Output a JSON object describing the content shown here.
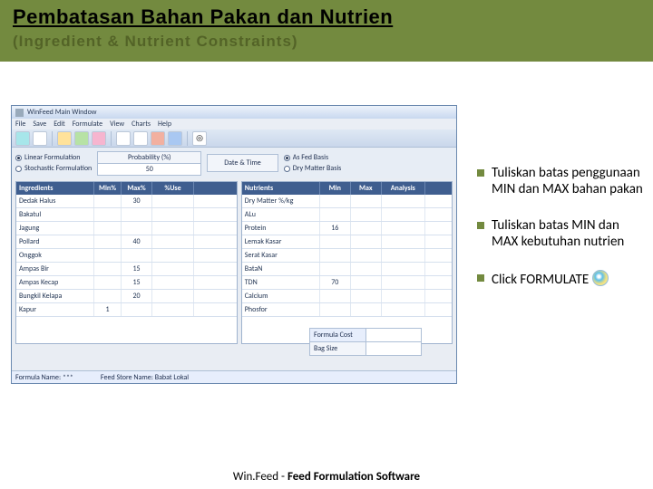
{
  "header": {
    "title": "Pembatasan Bahan Pakan dan Nutrien",
    "subtitle": "(Ingredient & Nutrient Constraints)"
  },
  "app": {
    "title": "WinFeed Main Window",
    "menu": [
      "File",
      "Save",
      "Edit",
      "Formulate",
      "View",
      "Charts",
      "Help"
    ],
    "options": {
      "linear_label": "Linear Formulation",
      "stochastic_label": "Stochastic Formulation",
      "prob_label": "Probability (%)",
      "prob_value": "50",
      "date_label": "Date & Time",
      "asfed_label": "As Fed Basis",
      "drymatter_label": "Dry Matter Basis"
    },
    "ing_head": [
      "Ingredients",
      "Min%",
      "Max%",
      "%Use"
    ],
    "ingredients": [
      {
        "name": "Dedak Halus",
        "min": "",
        "max": "30",
        "use": ""
      },
      {
        "name": "Bakatul",
        "min": "",
        "max": "",
        "use": ""
      },
      {
        "name": "Jagung",
        "min": "",
        "max": "",
        "use": ""
      },
      {
        "name": "Pollard",
        "min": "",
        "max": "40",
        "use": ""
      },
      {
        "name": "Onggok",
        "min": "",
        "max": "",
        "use": ""
      },
      {
        "name": "Ampas Bir",
        "min": "",
        "max": "15",
        "use": ""
      },
      {
        "name": "Ampas Kecap",
        "min": "",
        "max": "15",
        "use": ""
      },
      {
        "name": "Bungkil Kelapa",
        "min": "",
        "max": "20",
        "use": ""
      },
      {
        "name": "Kapur",
        "min": "1",
        "max": "",
        "use": ""
      }
    ],
    "nut_head": [
      "Nutrients",
      "Min",
      "Max",
      "Analysis"
    ],
    "nutrients": [
      {
        "name": "Dry Matter %/kg",
        "min": "",
        "max": "",
        "an": ""
      },
      {
        "name": "ALu",
        "min": "",
        "max": "",
        "an": ""
      },
      {
        "name": "Protein",
        "min": "16",
        "max": "",
        "an": ""
      },
      {
        "name": "Lemak Kasar",
        "min": "",
        "max": "",
        "an": ""
      },
      {
        "name": "Serat Kasar",
        "min": "",
        "max": "",
        "an": ""
      },
      {
        "name": "BataN",
        "min": "",
        "max": "",
        "an": ""
      },
      {
        "name": "TDN",
        "min": "70",
        "max": "",
        "an": ""
      },
      {
        "name": "Calcium",
        "min": "",
        "max": "",
        "an": ""
      },
      {
        "name": "Phosfor",
        "min": "",
        "max": "",
        "an": ""
      }
    ],
    "formbox": {
      "cost_label": "Formula Cost",
      "bag_label": "Bag Size",
      "cost_value": "",
      "bag_value": ""
    },
    "status": {
      "formula": "Formula Name:  ***",
      "store": "Feed Store Name:  Babat Lokal"
    }
  },
  "bullets": [
    "Tuliskan batas penggunaan MIN dan MAX bahan pakan",
    "Tuliskan batas MIN dan MAX kebutuhan nutrien",
    "Click FORMULATE"
  ],
  "footer_prefix": "Win.Feed -",
  "footer_rest": " Feed Formulation Software"
}
